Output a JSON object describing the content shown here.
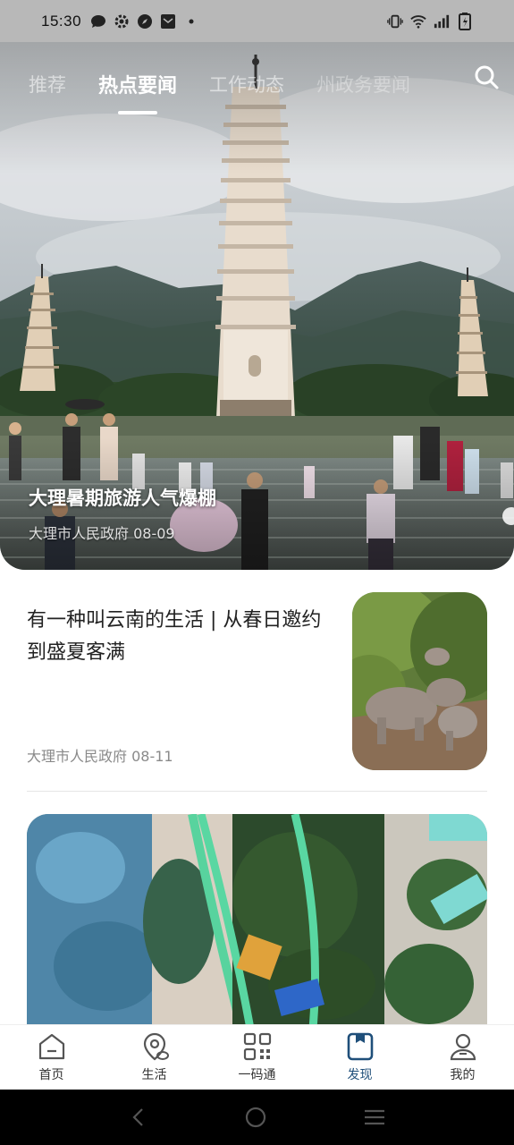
{
  "status_bar": {
    "time": "15:30",
    "left_icons": [
      "message-icon",
      "settings-icon",
      "compass-icon",
      "mail-icon",
      "dot-icon"
    ],
    "right_icons": [
      "vibrate-icon",
      "wifi-icon",
      "signal-icon",
      "battery-icon"
    ]
  },
  "top_tabs": [
    {
      "label": "推荐",
      "active": false
    },
    {
      "label": "热点要闻",
      "active": true
    },
    {
      "label": "工作动态",
      "active": false
    },
    {
      "label": "州政务要闻",
      "active": false
    }
  ],
  "hero": {
    "title": "大理暑期旅游人气爆棚",
    "meta": "大理市人民政府 08-09"
  },
  "article": {
    "title": "有一种叫云南的生活 | 从春日邀约到盛夏客满",
    "meta": "大理市人民政府 08-11"
  },
  "bottom_nav": [
    {
      "label": "首页",
      "icon": "home-icon",
      "active": false
    },
    {
      "label": "生活",
      "icon": "location-icon",
      "active": false
    },
    {
      "label": "一码通",
      "icon": "qrcode-icon",
      "active": false
    },
    {
      "label": "发现",
      "icon": "discover-icon",
      "active": true
    },
    {
      "label": "我的",
      "icon": "profile-icon",
      "active": false
    }
  ],
  "colors": {
    "accent": "#1f4f7a",
    "status_bar_bg": "#b8b8b8"
  }
}
